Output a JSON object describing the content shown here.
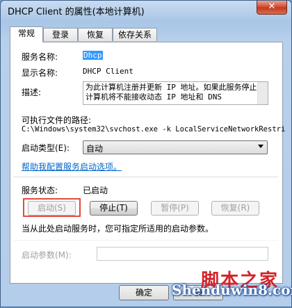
{
  "window": {
    "title": "DHCP Client 的属性(本地计算机)",
    "close_glyph": "✕"
  },
  "tabs": [
    {
      "label": "常规"
    },
    {
      "label": "登录"
    },
    {
      "label": "恢复"
    },
    {
      "label": "依存关系"
    }
  ],
  "general": {
    "service_name_label": "服务名称:",
    "service_name_value": "Dhcp",
    "display_name_label": "显示名称:",
    "display_name_value": "DHCP Client",
    "description_label": "描述:",
    "description_value": "为此计算机注册并更新 IP 地址。如果此服务停止，计算机将不能接收动态 IP 地址和 DNS",
    "exe_path_label": "可执行文件的路径:",
    "exe_path_value": "C:\\Windows\\system32\\svchost.exe -k LocalServiceNetworkRestri",
    "startup_type_label": "启动类型(E):",
    "startup_type_value": "自动",
    "help_link": "帮助我配置服务启动选项。",
    "status_label": "服务状态:",
    "status_value": "已启动",
    "buttons": {
      "start": "启动(S)",
      "stop": "停止(T)",
      "pause": "暂停(P)",
      "resume": "恢复(R)"
    },
    "hint": "当从此处启动服务时，您可指定所适用的启动参数。",
    "param_label": "启动参数(M):"
  },
  "footer": {
    "ok": "确定",
    "cancel_partial": "确"
  },
  "watermark": {
    "cn": "脚本之家",
    "en": "Shenduwin8.com"
  }
}
